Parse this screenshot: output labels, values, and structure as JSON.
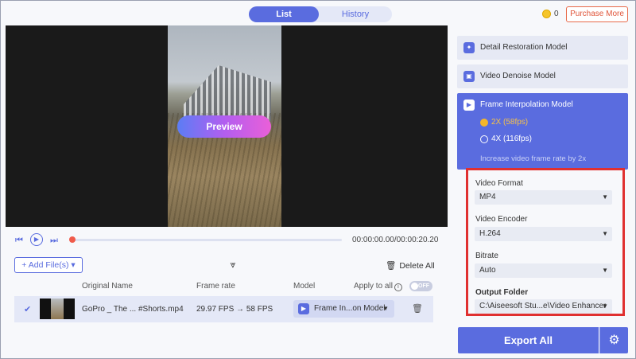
{
  "tabs": [
    {
      "label": "List",
      "active": true
    },
    {
      "label": "History",
      "active": false
    }
  ],
  "header": {
    "coin_count": "0",
    "purchase_label": "Purchase More",
    "coin_icon": "coin-icon"
  },
  "preview": {
    "button_label": "Preview"
  },
  "playback": {
    "timecode": "00:00:00.00/00:00:20.20",
    "progress": 0.0,
    "prev_icon": "skip-prev-icon",
    "play_icon": "play-icon",
    "next_icon": "skip-next-icon"
  },
  "toolbar": {
    "add_files_label": "+ Add File(s) ▾",
    "delete_all_label": "Delete All"
  },
  "table": {
    "headers": {
      "name": "Original Name",
      "frame_rate": "Frame rate",
      "model": "Model",
      "apply_all": "Apply to all",
      "toggle_label": "OFF"
    },
    "rows": [
      {
        "name": "GoPro _ The ... #Shorts.mp4",
        "fps_from": "29.97 FPS",
        "fps_to": "58 FPS",
        "model": "Frame In...on Model"
      }
    ]
  },
  "models": {
    "detail_restoration": "Detail Restoration Model",
    "video_denoise": "Video Denoise Model",
    "frame_interpolation": "Frame Interpolation Model",
    "options": [
      {
        "label": "2X (58fps)",
        "selected": true
      },
      {
        "label": "4X (116fps)",
        "selected": false
      }
    ],
    "description": "Increase video frame rate by 2x"
  },
  "settings": {
    "video_format_label": "Video Format",
    "video_format_value": "MP4",
    "video_encoder_label": "Video Encoder",
    "video_encoder_value": "H.264",
    "bitrate_label": "Bitrate",
    "bitrate_value": "Auto",
    "output_folder_label": "Output Folder",
    "output_folder_value": "C:\\Aiseesoft Stu...e\\Video Enhancer"
  },
  "export": {
    "label": "Export All"
  },
  "colors": {
    "accent": "#5a6cdf",
    "highlight_border": "#e03030",
    "purchase": "#e0553a"
  }
}
